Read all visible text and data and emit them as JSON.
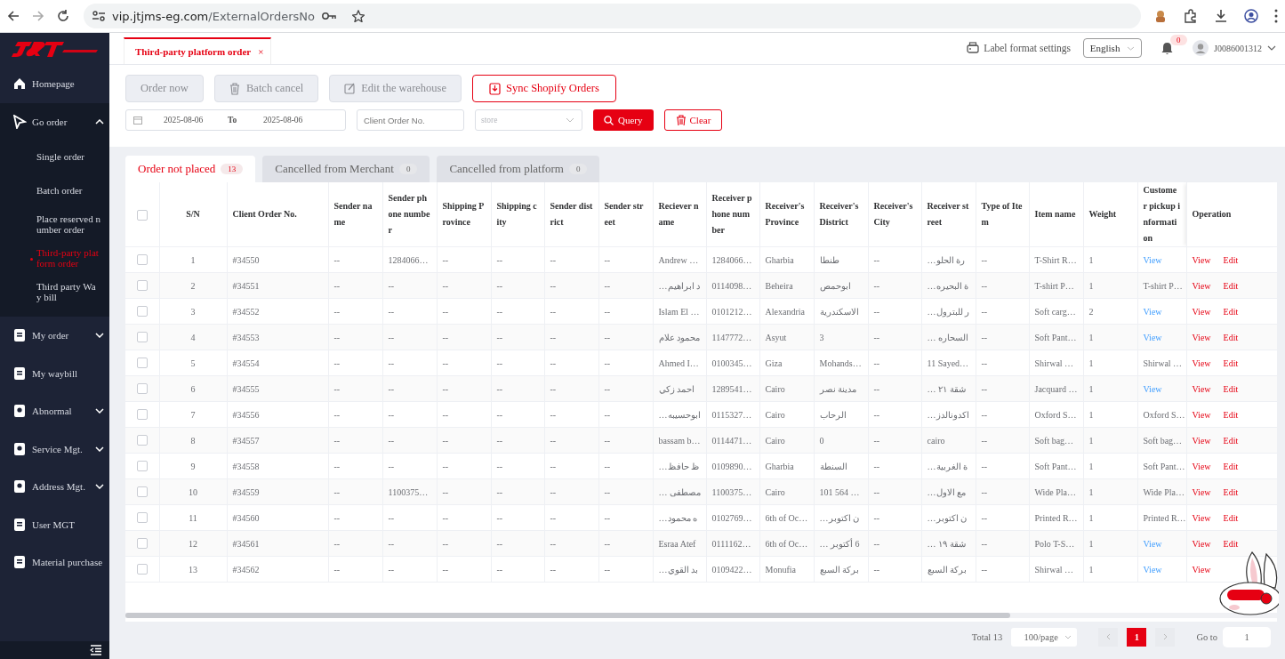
{
  "browser": {
    "url_host": "vip.jtjms-eg.com",
    "url_path": "/ExternalOrdersNo"
  },
  "sidebar": {
    "items": [
      {
        "label": "Homepage"
      },
      {
        "label": "Go order",
        "expanded": true,
        "children": [
          {
            "label": "Single order",
            "selected": false
          },
          {
            "label": "Batch order",
            "selected": false
          },
          {
            "label": "Place reserved number order",
            "selected": false
          },
          {
            "label": "Third-party platform order",
            "selected": true
          },
          {
            "label": "Third party Way bill",
            "selected": false
          }
        ]
      },
      {
        "label": "My order",
        "expanded": false
      },
      {
        "label": "My waybill"
      },
      {
        "label": "Abnormal",
        "expanded": false
      },
      {
        "label": "Service Mgt.",
        "expanded": false
      },
      {
        "label": "Address Mgt.",
        "expanded": false
      },
      {
        "label": "User MGT"
      },
      {
        "label": "Material purchase"
      }
    ]
  },
  "header": {
    "tabs": [
      {
        "label": "Third-party platform order",
        "selected": true,
        "close": "×"
      }
    ],
    "label_settings": "Label format settings",
    "language": "English",
    "notifications": "0",
    "user": "J0086001312"
  },
  "toolbar": {
    "buttons": [
      {
        "label": "Order now",
        "disabled": true
      },
      {
        "label": "Batch cancel",
        "disabled": true
      },
      {
        "label": "Edit the warehouse",
        "disabled": true
      },
      {
        "label": "Sync Shopify Orders",
        "disabled": false
      }
    ],
    "date_from": "2025-08-06",
    "date_sep": "To",
    "date_to": "2025-08-06",
    "order_placeholder": "Client Order No.",
    "store_placeholder": "store",
    "query": "Query",
    "clear": "Clear"
  },
  "status_tabs": [
    {
      "label": "Order not placed",
      "count": "13",
      "selected": true
    },
    {
      "label": "Cancelled from Merchant",
      "count": "0",
      "selected": false
    },
    {
      "label": "Cancelled from platform",
      "count": "0",
      "selected": false
    }
  ],
  "table": {
    "select_all_checked": false,
    "columns": [
      "S/N",
      "Client Order No.",
      "Sender name",
      "Sender phone number",
      "Shipping Province",
      "Shipping city",
      "Sender district",
      "Sender street",
      "Reciever name",
      "Receiver phone number",
      "Receiver's Province",
      "Receiver's District",
      "Receiver's City",
      "Receiver street",
      "Type of Item",
      "Item name",
      "Weight",
      "Customer pickup information",
      "Operation"
    ],
    "rows": [
      {
        "checked": false,
        "cells": [
          "1",
          "#34550",
          "--",
          "1284066…",
          "--",
          "--",
          "--",
          "--",
          "Andrew …",
          "1284066…",
          "Gharbia",
          "طنطا",
          "--",
          "رة الحلو…",
          "--",
          "T-Shirt R…",
          "1"
        ],
        "pickup": {
          "kind": "link",
          "text": "View"
        },
        "operations": [
          "View",
          "Edit"
        ]
      },
      {
        "checked": false,
        "cells": [
          "2",
          "#34551",
          "--",
          "--",
          "--",
          "--",
          "--",
          "--",
          "د ابراهيم…",
          "0114098…",
          "Beheira",
          "ابوحمص",
          "--",
          "ة البحيره…",
          "--",
          "T-shirt P…",
          "1"
        ],
        "pickup": {
          "kind": "text",
          "text": "T-shirt P…"
        },
        "operations": [
          "View",
          "Edit"
        ]
      },
      {
        "checked": false,
        "cells": [
          "3",
          "#34552",
          "--",
          "--",
          "--",
          "--",
          "--",
          "--",
          "Islam El …",
          "0101212…",
          "Alexandria",
          "الاسكندرية",
          "--",
          "ر للبترول…",
          "--",
          "Soft carg…",
          "2"
        ],
        "pickup": {
          "kind": "link",
          "text": "View"
        },
        "operations": [
          "View",
          "Edit"
        ]
      },
      {
        "checked": false,
        "cells": [
          "4",
          "#34553",
          "--",
          "--",
          "--",
          "--",
          "--",
          "--",
          "محمود علام",
          "1147772…",
          "Asyut",
          "3",
          "--",
          "السحاره …",
          "--",
          "Soft Pant…",
          "1"
        ],
        "pickup": {
          "kind": "link",
          "text": "View"
        },
        "operations": [
          "View",
          "Edit"
        ]
      },
      {
        "checked": false,
        "cells": [
          "5",
          "#34554",
          "--",
          "--",
          "--",
          "--",
          "--",
          "--",
          "Ahmed I…",
          "0100345…",
          "Giza",
          "Mohands…",
          "--",
          "11 Sayed…",
          "--",
          "Shirwal …",
          "1"
        ],
        "pickup": {
          "kind": "text",
          "text": "Shirwal …"
        },
        "operations": [
          "View",
          "Edit"
        ]
      },
      {
        "checked": false,
        "cells": [
          "6",
          "#34555",
          "--",
          "--",
          "--",
          "--",
          "--",
          "--",
          "احمد زكي",
          "1289541…",
          "Cairo",
          "مدينة نصر",
          "--",
          "شقة ٢١ …",
          "--",
          "Jacquard …",
          "1"
        ],
        "pickup": {
          "kind": "link",
          "text": "View"
        },
        "operations": [
          "View",
          "Edit"
        ]
      },
      {
        "checked": false,
        "cells": [
          "7",
          "#34556",
          "--",
          "--",
          "--",
          "--",
          "--",
          "--",
          "ابوحسيبه…",
          "0115327…",
          "Cairo",
          "الرحاب",
          "--",
          "اكدونالدز…",
          "--",
          "Oxford S…",
          "1"
        ],
        "pickup": {
          "kind": "text",
          "text": "Oxford S…"
        },
        "operations": [
          "View",
          "Edit"
        ]
      },
      {
        "checked": false,
        "cells": [
          "8",
          "#34557",
          "--",
          "--",
          "--",
          "--",
          "--",
          "--",
          "bassam b…",
          "0114471…",
          "Cairo",
          "0",
          "--",
          "cairo",
          "--",
          "Soft bag…",
          "1"
        ],
        "pickup": {
          "kind": "text",
          "text": "Soft bag…"
        },
        "operations": [
          "View",
          "Edit"
        ]
      },
      {
        "checked": false,
        "cells": [
          "9",
          "#34558",
          "--",
          "--",
          "--",
          "--",
          "--",
          "--",
          "ظ حافظ…",
          "0109890…",
          "Gharbia",
          "السنطة",
          "--",
          "ة الغربية…",
          "--",
          "Soft Pant…",
          "1"
        ],
        "pickup": {
          "kind": "text",
          "text": "Soft Pant…"
        },
        "operations": [
          "View",
          "Edit"
        ]
      },
      {
        "checked": false,
        "cells": [
          "10",
          "#34559",
          "--",
          "1100375…",
          "--",
          "--",
          "--",
          "--",
          "مصطفى …",
          "1100375…",
          "Cairo",
          "101 564 …",
          "--",
          "مع الاول…",
          "--",
          "Wide Pla…",
          "1"
        ],
        "pickup": {
          "kind": "text",
          "text": "Wide Pla…"
        },
        "operations": [
          "View",
          "Edit"
        ]
      },
      {
        "checked": false,
        "cells": [
          "11",
          "#34560",
          "--",
          "--",
          "--",
          "--",
          "--",
          "--",
          "ه محمود…",
          "0102769…",
          "6th of Oc…",
          "ن اكتوبر…",
          "--",
          "ن اكتوبر…",
          "--",
          "Printed R…",
          "1"
        ],
        "pickup": {
          "kind": "text",
          "text": "Printed R…"
        },
        "operations": [
          "View",
          "Edit"
        ]
      },
      {
        "checked": false,
        "cells": [
          "12",
          "#34561",
          "--",
          "--",
          "--",
          "--",
          "--",
          "--",
          "Esraa Atef",
          "0111162…",
          "6th of Oc…",
          "6 أكتوبر …",
          "--",
          "شقة ١٩ …",
          "--",
          "Polo T-S…",
          "1"
        ],
        "pickup": {
          "kind": "link",
          "text": "View"
        },
        "operations": [
          "View",
          "Edit"
        ]
      },
      {
        "checked": false,
        "cells": [
          "13",
          "#34562",
          "--",
          "--",
          "--",
          "--",
          "--",
          "--",
          "بد القوي…",
          "0109422…",
          "Monufia",
          "بركة السبع",
          "--",
          "بركة السبع",
          "--",
          "Shirwal …",
          "1"
        ],
        "pickup": {
          "kind": "link",
          "text": "View"
        },
        "operations": [
          "View"
        ]
      }
    ]
  },
  "pagination": {
    "total": "Total 13",
    "page_size": "100/page",
    "pages": [
      {
        "label": "1",
        "selected": true
      }
    ],
    "goto_label": "Go to",
    "goto_value": "1"
  }
}
